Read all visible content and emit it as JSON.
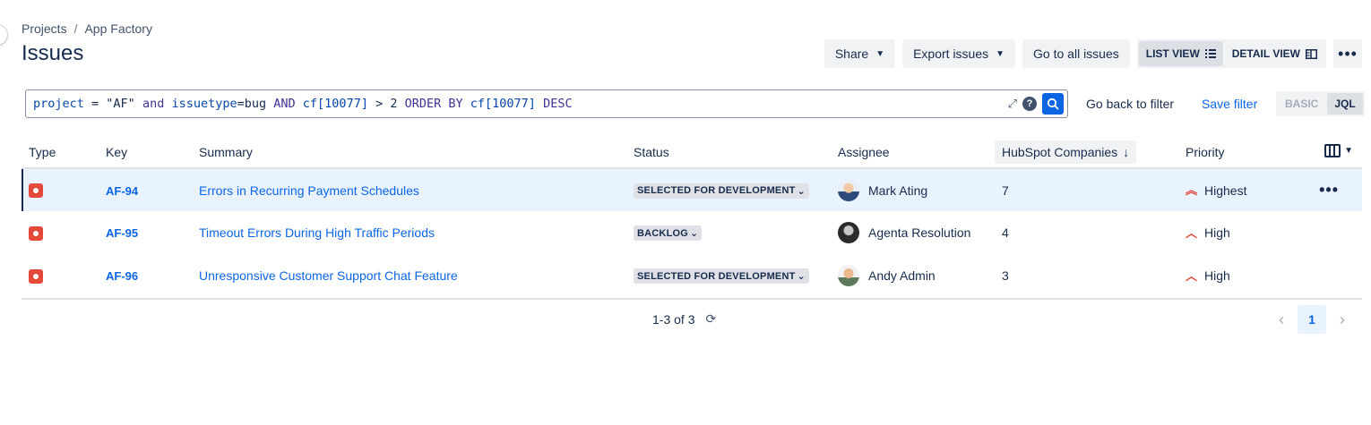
{
  "breadcrumb": {
    "items": [
      "Projects",
      "App Factory"
    ],
    "separator": "/"
  },
  "page": {
    "title": "Issues"
  },
  "actions": {
    "share": "Share",
    "export": "Export issues",
    "go_all": "Go to all issues",
    "list_view": "LIST VIEW",
    "detail_view": "DETAIL VIEW"
  },
  "jql": {
    "parts": {
      "p1": "project",
      "p2": " = \"AF\" ",
      "p3": "and",
      "p4": " ",
      "p5": "issuetype",
      "p6": "=bug ",
      "p7": "AND",
      "p8": " ",
      "p9": "cf[10077]",
      "p10": " > 2 ",
      "p11": "ORDER BY",
      "p12": " ",
      "p13": "cf[10077]",
      "p14": " ",
      "p15": "DESC"
    },
    "go_back": "Go back to filter",
    "save_filter": "Save filter",
    "basic": "BASIC",
    "jql_mode": "JQL"
  },
  "table": {
    "headers": {
      "type": "Type",
      "key": "Key",
      "summary": "Summary",
      "status": "Status",
      "assignee": "Assignee",
      "companies": "HubSpot Companies",
      "priority": "Priority"
    },
    "rows": [
      {
        "key": "AF-94",
        "summary": "Errors in Recurring Payment Schedules",
        "status": "SELECTED FOR DEVELOPMENT",
        "assignee": "Mark Ating",
        "companies": "7",
        "priority": "Highest"
      },
      {
        "key": "AF-95",
        "summary": "Timeout Errors During High Traffic Periods",
        "status": "BACKLOG",
        "assignee": "Agenta Resolution",
        "companies": "4",
        "priority": "High"
      },
      {
        "key": "AF-96",
        "summary": "Unresponsive Customer Support Chat Feature",
        "status": "SELECTED FOR DEVELOPMENT",
        "assignee": "Andy Admin",
        "companies": "3",
        "priority": "High"
      }
    ]
  },
  "pagination": {
    "range": "1-3 of 3",
    "current_page": "1"
  },
  "colors": {
    "accent": "#0c66e4",
    "bug": "#e5493a",
    "selected_row": "#e9f2ff"
  },
  "icons": [
    "bug-icon",
    "chevron-down-icon",
    "more-icon",
    "list-view-icon",
    "detail-view-icon",
    "expand-icon",
    "help-icon",
    "search-icon",
    "sort-down-icon",
    "columns-icon",
    "priority-highest-icon",
    "priority-high-icon",
    "refresh-icon",
    "chevron-left-icon",
    "chevron-right-icon"
  ]
}
